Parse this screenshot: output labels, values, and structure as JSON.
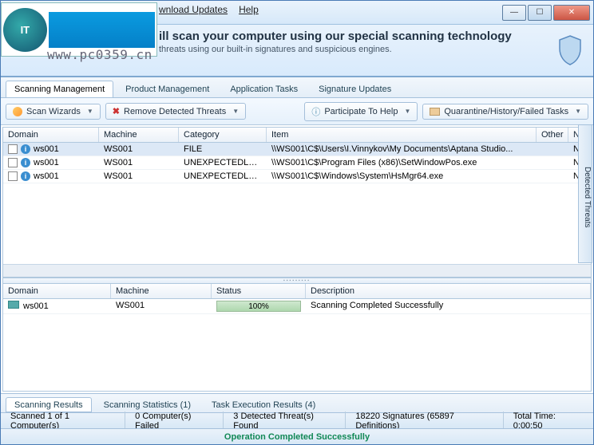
{
  "watermark": "www.pc0359.cn",
  "menu": {
    "download": "wnload Updates",
    "help": "Help"
  },
  "banner": {
    "title": "ill scan your computer using our special scanning technology",
    "subtitle": "threats using our built-in signatures and suspicious engines."
  },
  "tabs": {
    "scanning": "Scanning Management",
    "product": "Product Management",
    "apptasks": "Application Tasks",
    "sigupd": "Signature Updates"
  },
  "toolbar": {
    "wizards": "Scan Wizards",
    "remove": "Remove Detected Threats",
    "participate": "Participate To Help",
    "quarantine": "Quarantine/History/Failed Tasks"
  },
  "topgrid": {
    "cols": {
      "domain": "Domain",
      "machine": "Machine",
      "category": "Category",
      "item": "Item",
      "other": "Other",
      "na": "Na..."
    },
    "rows": [
      {
        "domain": "ws001",
        "machine": "WS001",
        "category": "FILE",
        "item": "\\\\WS001\\C$\\Users\\I.Vinnykov\\My Documents\\Aptana Studio...",
        "na": "NM"
      },
      {
        "domain": "ws001",
        "machine": "WS001",
        "category": "UNEXPECTEDLOCATI...",
        "item": "\\\\WS001\\C$\\Program Files (x86)\\SetWindowPos.exe",
        "na": "NM"
      },
      {
        "domain": "ws001",
        "machine": "WS001",
        "category": "UNEXPECTEDLOCATI...",
        "item": "\\\\WS001\\C$\\Windows\\System\\HsMgr64.exe",
        "na": "NM"
      }
    ],
    "sidebar": "Detected Threats"
  },
  "botgrid": {
    "cols": {
      "domain": "Domain",
      "machine": "Machine",
      "status": "Status",
      "description": "Description"
    },
    "row": {
      "domain": "ws001",
      "machine": "WS001",
      "status": "100%",
      "description": "Scanning Completed Successfully"
    }
  },
  "bottabs": {
    "results": "Scanning Results",
    "stats": "Scanning Statistics (1)",
    "taskexec": "Task Execution Results (4)"
  },
  "status": {
    "scanned": "Scanned 1 of 1 Computer(s)",
    "failed": "0 Computer(s) Failed",
    "threats": "3 Detected Threat(s) Found",
    "sigs": "18220 Signatures (65897 Definitions)",
    "time": "Total Time: 0:00:50",
    "operation": "Operation Completed Successfully"
  }
}
